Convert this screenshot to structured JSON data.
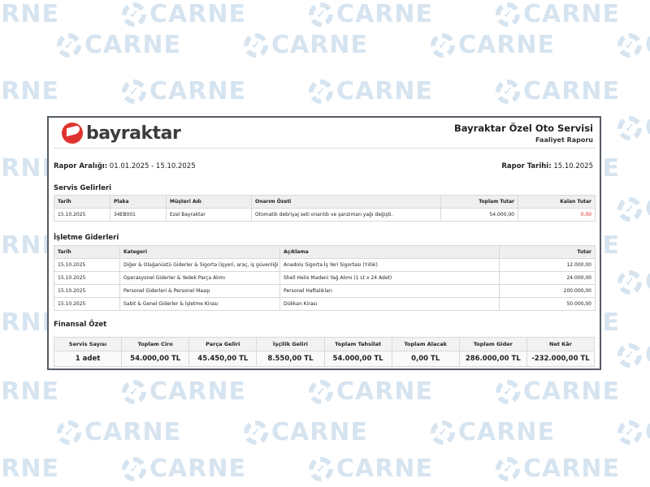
{
  "watermark": {
    "text": "CARNE",
    "icon": "check-gear-icon"
  },
  "brand": {
    "logo_text": "bayraktar"
  },
  "company": {
    "name": "Bayraktar Özel Oto Servisi",
    "subtitle": "Faaliyet Raporu"
  },
  "report": {
    "range_label": "Rapor Aralığı:",
    "range_value": " 01.01.2025 - 15.10.2025",
    "date_label": "Rapor Tarihi:",
    "date_value": " 15.10.2025"
  },
  "service": {
    "title": "Servis Gelirleri",
    "headers": [
      "Tarih",
      "Plaka",
      "Müşteri Adı",
      "Onarım Özeti",
      "Toplam Tutar",
      "Kalan Tutar"
    ],
    "rows": [
      [
        "15.10.2025",
        "34EB001",
        "Ezel Bayraktar",
        "Otomatik debriyaj seti onarıldı ve şanzıman yağı değişti.",
        "54.000,00",
        "0,00"
      ]
    ]
  },
  "expenses": {
    "title": "İşletme Giderleri",
    "headers": [
      "Tarih",
      "Kategori",
      "Açıklama",
      "Tutar"
    ],
    "rows": [
      [
        "15.10.2025",
        "Diğer & Olağanüstü Giderler & Sigorta (işyeri, araç, iş güvenliği vs.)",
        "Anadolu Sigorta İş Yeri Sigortası (Yıllık)",
        "12.000,00"
      ],
      [
        "15.10.2025",
        "Operasyonel Giderler & Yedek Parça Alımı",
        "Shell Helix Madeni Yağ Alımı (1 Lt x 24 Adet)",
        "24.000,00"
      ],
      [
        "15.10.2025",
        "Personel Giderleri & Personel Maaşı",
        "Personel Haftalıkları",
        "200.000,00"
      ],
      [
        "15.10.2025",
        "Sabit & Genel Giderler & İşletme Kirası",
        "Dükkan Kirası",
        "50.000,00"
      ]
    ]
  },
  "summary": {
    "title": "Finansal Özet",
    "headers": [
      "Servis Sayısı",
      "Toplam Ciro",
      "Parça Geliri",
      "İşçilik Geliri",
      "Toplam Tahsilat",
      "Toplam Alacak",
      "Toplam Gider",
      "Net Kâr"
    ],
    "values": [
      "1 adet",
      "54.000,00 TL",
      "45.450,00 TL",
      "8.550,00 TL",
      "54.000,00 TL",
      "0,00 TL",
      "286.000,00 TL",
      "-232.000,00 TL"
    ]
  },
  "colors": {
    "accent": "#e0332f",
    "watermark": "#d6e4f0",
    "negative": "#e02020",
    "border": "#555c66"
  }
}
